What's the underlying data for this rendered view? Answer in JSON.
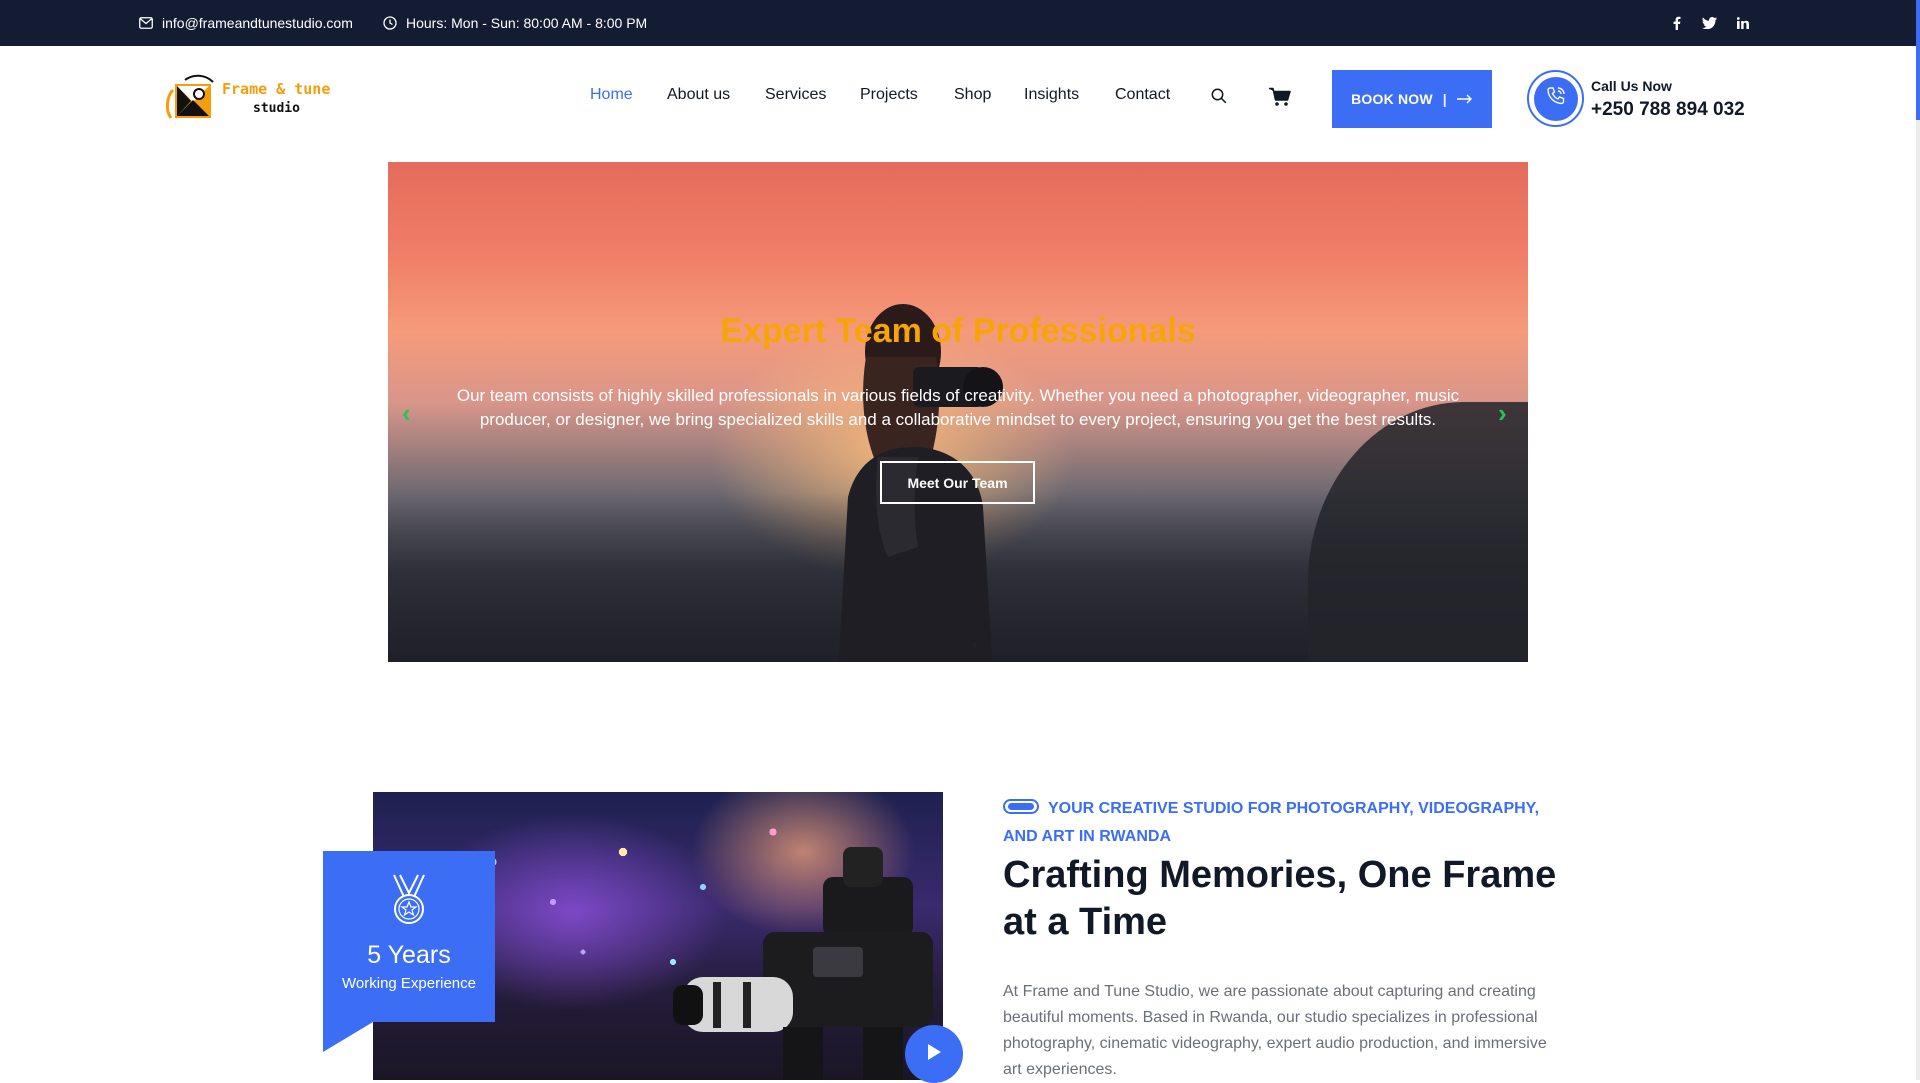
{
  "topbar": {
    "email": "info@frameandtunestudio.com",
    "hours": "Hours: Mon - Sun: 80:00 AM - 8:00 PM",
    "social": [
      "facebook-icon",
      "twitter-icon",
      "linkedin-icon"
    ]
  },
  "logo": {
    "line1": "Frame & tune",
    "line2": "studio"
  },
  "nav": {
    "items": [
      "Home",
      "About us",
      "Services",
      "Projects",
      "Shop",
      "Insights",
      "Contact"
    ],
    "active": "Home"
  },
  "header": {
    "book_label": "BOOK NOW",
    "book_sep": "|",
    "call_label": "Call Us Now",
    "call_number": "+250 788 894 032"
  },
  "hero": {
    "title": "Expert Team of Professionals",
    "description": "Our team consists of highly skilled professionals in various fields of creativity. Whether you need a photographer, videographer, music producer, or designer, we bring specialized skills and a collaborative mindset to every project, ensuring you get the best results.",
    "button": "Meet Our Team",
    "prev": "‹",
    "next": "›"
  },
  "about": {
    "badge_years": "5 Years",
    "badge_label": "Working Experience",
    "eyebrow": "YOUR CREATIVE STUDIO FOR PHOTOGRAPHY, VIDEOGRAPHY, AND ART IN RWANDA",
    "title": "Crafting Memories, One Frame at a Time",
    "text": "At Frame and Tune Studio, we are passionate about capturing and creating beautiful moments. Based in Rwanda, our studio specializes in professional photography, cinematic videography, expert audio production, and immersive art experiences."
  },
  "colors": {
    "accent": "#3b6ef5",
    "topbar": "#131c33",
    "hero_title": "#f5a50a",
    "arrow": "#22c55e"
  }
}
